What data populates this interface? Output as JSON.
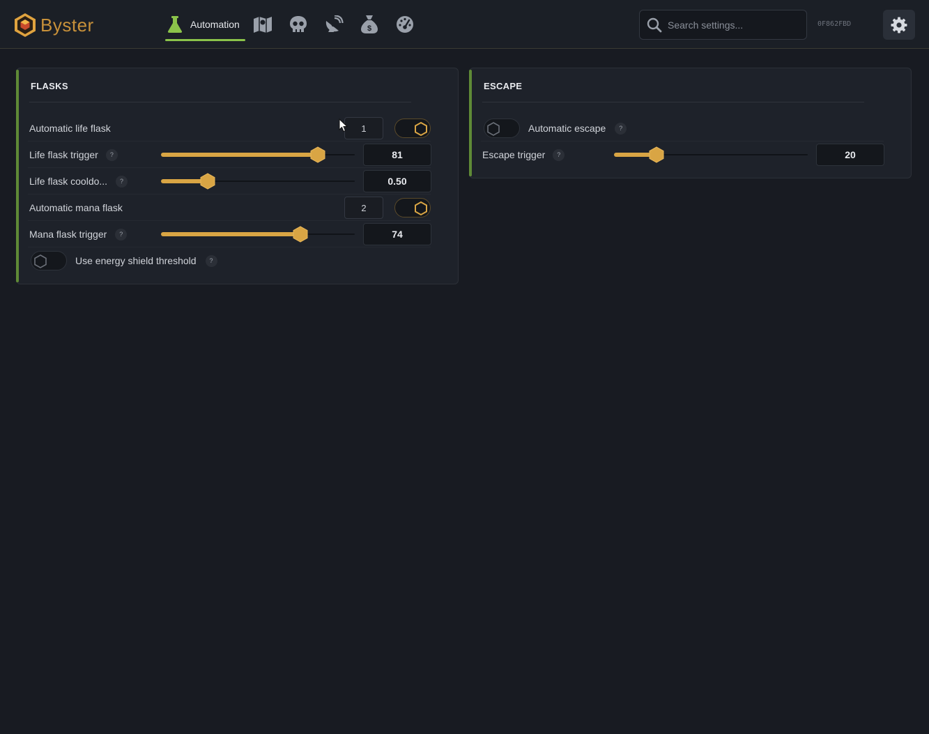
{
  "app": {
    "name": "Byster",
    "device_id": "0F862FBD"
  },
  "nav": {
    "active_tab": "Automation",
    "icons": [
      "flask-icon",
      "map-icon",
      "skull-icon",
      "radar-icon",
      "money-bag-icon",
      "speedometer-icon"
    ]
  },
  "search": {
    "placeholder": "Search settings..."
  },
  "colors": {
    "accent": "#d9a544",
    "panel_bar": "#5f8a36",
    "tab_underline": "#8bc34a",
    "background": "#181b22"
  },
  "flasks": {
    "title": "FLASKS",
    "auto_life": {
      "label": "Automatic life flask",
      "key": "1",
      "enabled": true
    },
    "life_trigger": {
      "label": "Life flask trigger",
      "value": "81",
      "level": 0.81
    },
    "life_cooldown": {
      "label": "Life flask cooldo...",
      "value": "0.50",
      "level": 0.24
    },
    "auto_mana": {
      "label": "Automatic mana flask",
      "key": "2",
      "enabled": true
    },
    "mana_trigger": {
      "label": "Mana flask trigger",
      "value": "74",
      "level": 0.72
    },
    "energy_shield": {
      "label": "Use energy shield threshold",
      "enabled": false
    },
    "help": "?"
  },
  "escape": {
    "title": "ESCAPE",
    "auto_escape": {
      "label": "Automatic escape",
      "enabled": false
    },
    "escape_trigger": {
      "label": "Escape trigger",
      "value": "20",
      "level": 0.22
    },
    "help": "?"
  }
}
